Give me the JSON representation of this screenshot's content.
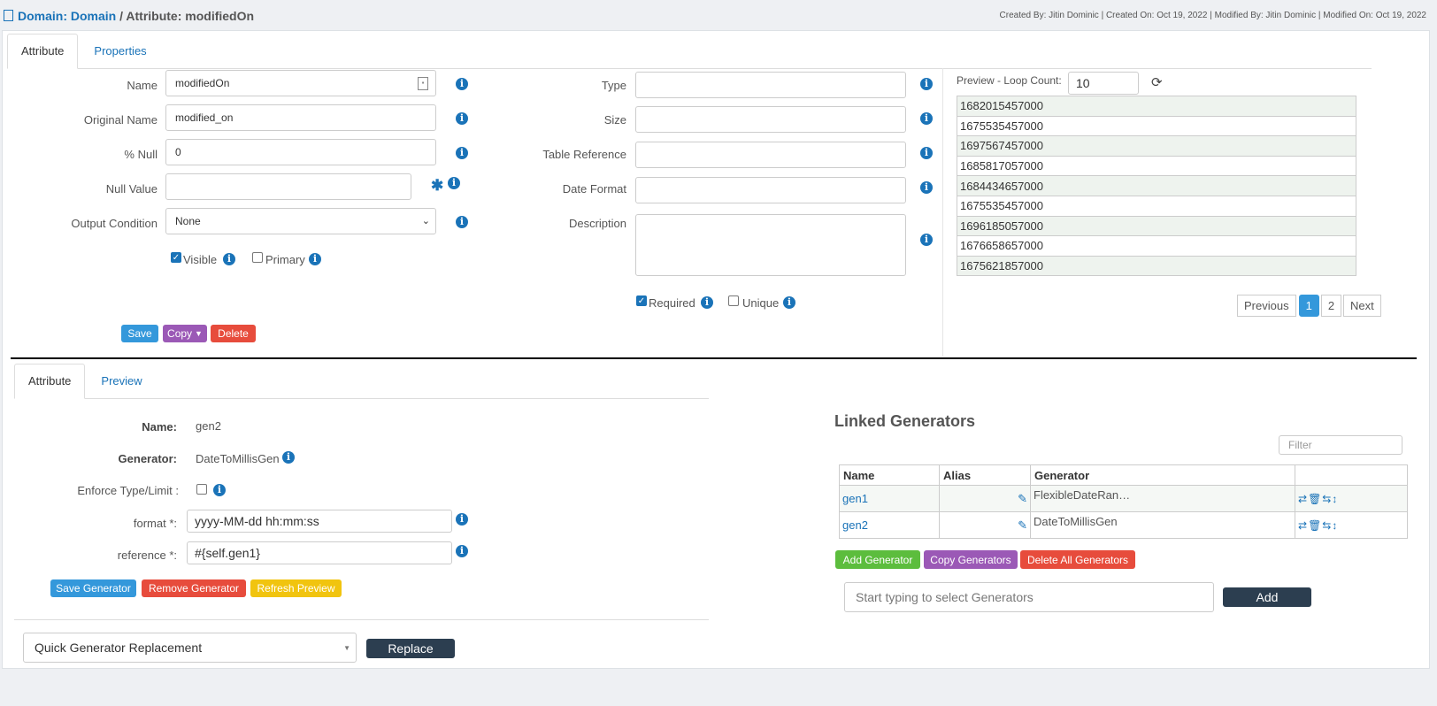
{
  "breadcrumb": {
    "domain_link": "Domain: Domain",
    "separator": " / ",
    "current": "Attribute: modifiedOn"
  },
  "meta_info": "Created By: Jitin Dominic | Created On: Oct 19, 2022 | Modified By: Jitin Dominic | Modified On: Oct 19, 2022",
  "top_tabs": [
    {
      "label": "Attribute",
      "active": true
    },
    {
      "label": "Properties",
      "active": false
    }
  ],
  "attr_form": {
    "name_label": "Name",
    "name_value": "modifiedOn",
    "original_name_label": "Original Name",
    "original_name_value": "modified_on",
    "null_pct_label": "% Null",
    "null_pct_value": "0",
    "null_value_label": "Null Value",
    "null_value_value": "",
    "output_condition_label": "Output Condition",
    "output_condition_value": "None",
    "visible_label": "Visible",
    "visible_checked": true,
    "primary_label": "Primary",
    "primary_checked": false,
    "type_label": "Type",
    "type_value": "",
    "size_label": "Size",
    "size_value": "",
    "table_ref_label": "Table Reference",
    "table_ref_value": "",
    "date_format_label": "Date Format",
    "date_format_value": "",
    "description_label": "Description",
    "description_value": "",
    "required_label": "Required",
    "required_checked": true,
    "unique_label": "Unique",
    "unique_checked": false
  },
  "buttons": {
    "save": "Save",
    "copy": "Copy",
    "delete": "Delete"
  },
  "preview": {
    "loop_label": "Preview - Loop Count:",
    "loop_value": "10",
    "rows": [
      "1682015457000",
      "1675535457000",
      "1697567457000",
      "1685817057000",
      "1684434657000",
      "1675535457000",
      "1696185057000",
      "1676658657000",
      "1675621857000"
    ],
    "pager": {
      "previous": "Previous",
      "pages": [
        "1",
        "2"
      ],
      "current": "1",
      "next": "Next"
    }
  },
  "gen_tabs": [
    {
      "label": "Attribute",
      "active": true
    },
    {
      "label": "Preview",
      "active": false
    }
  ],
  "gen_form": {
    "name_label": "Name:",
    "name_value": "gen2",
    "generator_label": "Generator:",
    "generator_value": "DateToMillisGen",
    "enforce_label": "Enforce Type/Limit :",
    "enforce_checked": false,
    "format_label": "format *:",
    "format_value": "yyyy-MM-dd hh:mm:ss",
    "reference_label": "reference *:",
    "reference_value": "#{self.gen1}"
  },
  "gen_buttons": {
    "save": "Save Generator",
    "remove": "Remove Generator",
    "refresh": "Refresh Preview"
  },
  "replacement": {
    "placeholder": "Quick Generator Replacement",
    "button": "Replace"
  },
  "linked": {
    "title": "Linked Generators",
    "filter_placeholder": "Filter",
    "columns": [
      "Name",
      "Alias",
      "Generator",
      ""
    ],
    "rows": [
      {
        "name": "gen1",
        "alias": "",
        "generator": "FlexibleDateRan…"
      },
      {
        "name": "gen2",
        "alias": "",
        "generator": "DateToMillisGen"
      }
    ],
    "buttons": {
      "add": "Add Generator",
      "copy": "Copy Generators",
      "delete_all": "Delete All Generators"
    },
    "select_placeholder": "Start typing to select Generators",
    "add_button": "Add"
  },
  "colors": {
    "link": "#1a73b8",
    "save": "#3498db",
    "copy": "#9b59b6",
    "delete": "#e74c3c",
    "refresh": "#f1c40f",
    "add": "#5cbd3d",
    "dark": "#2c3e50"
  }
}
